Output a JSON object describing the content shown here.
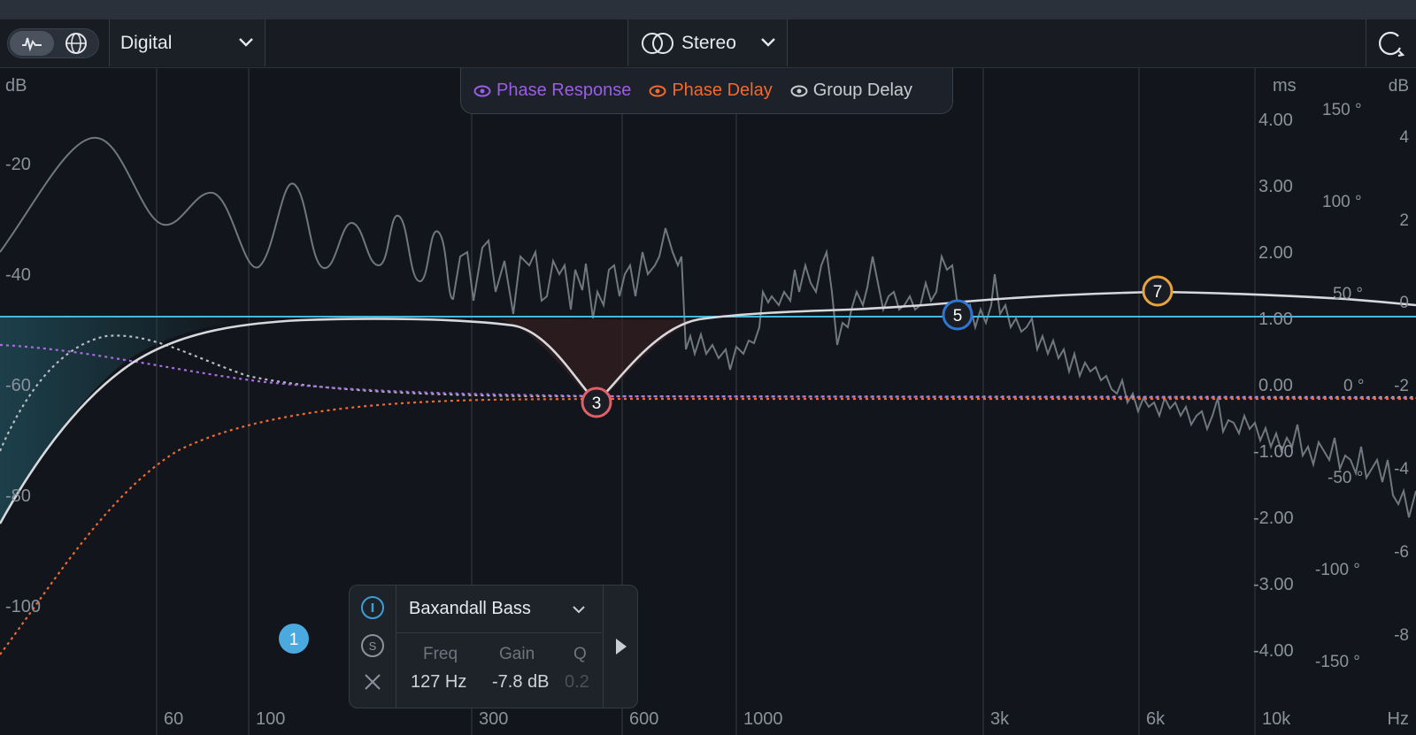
{
  "toolbar": {
    "mode": "Digital",
    "channel": "Stereo"
  },
  "legend": [
    {
      "label": "Phase Response",
      "color": "#9b5de5",
      "icon": "eye-icon"
    },
    {
      "label": "Phase Delay",
      "color": "#f0692f",
      "icon": "eye-icon"
    },
    {
      "label": "Group Delay",
      "color": "#c8ccd2",
      "icon": "eye-icon"
    }
  ],
  "axes": {
    "left_unit": "dB",
    "left_ticks": [
      "-20",
      "-40",
      "-60",
      "-80",
      "-100"
    ],
    "ms_unit": "ms",
    "ms_ticks": [
      "4.00",
      "3.00",
      "2.00",
      "1.00",
      "0.00",
      "-1.00",
      "-2.00",
      "-3.00",
      "-4.00"
    ],
    "deg_ticks": [
      "150 °",
      "100 °",
      "50 °",
      "0 °",
      "-50 °",
      "-100 °",
      "-150 °"
    ],
    "right_unit": "dB",
    "right_ticks": [
      "4",
      "2",
      "0",
      "-2",
      "-4",
      "-6",
      "-8"
    ],
    "freq_ticks": [
      "60",
      "100",
      "300",
      "600",
      "1000",
      "3k",
      "6k",
      "10k"
    ],
    "freq_unit": "Hz"
  },
  "nodes": [
    {
      "label": "1",
      "color": "#4aa9de"
    },
    {
      "label": "3",
      "color": "#e0606a"
    },
    {
      "label": "5",
      "color": "#2f76d2"
    },
    {
      "label": "7",
      "color": "#e8a33e"
    }
  ],
  "band": {
    "type": "Baxandall Bass",
    "freq_label": "Freq",
    "gain_label": "Gain",
    "q_label": "Q",
    "freq": "127 Hz",
    "gain": "-7.8 dB",
    "q": "0.2"
  },
  "colors": {
    "accent_blue": "#49b6e0",
    "eq_curve": "#d6d8dc",
    "spectrum": "#6f7780"
  }
}
